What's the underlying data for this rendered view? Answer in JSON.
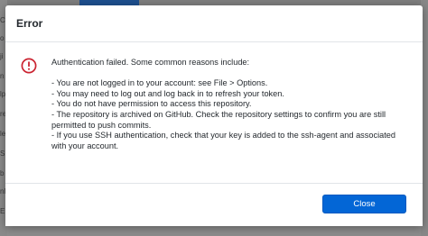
{
  "dialog": {
    "title": "Error",
    "icon": "error-circle-icon",
    "intro": "Authentication failed. Some common reasons include:",
    "reasons": [
      "- You are not logged in to your account: see File > Options.",
      "- You may need to log out and log back in to refresh your token.",
      "- You do not have permission to access this repository.",
      "- The repository is archived on GitHub. Check the repository settings to confirm you are still",
      "permitted to push commits.",
      "- If you use SSH authentication, check that your key is added to the ssh-agent and associated",
      "with your account."
    ],
    "close_label": "Close"
  },
  "background": {
    "side_fragments": [
      "C",
      "o",
      "ji",
      "n",
      "lp",
      "re",
      "le",
      "S",
      "b",
      "nl",
      "E"
    ]
  },
  "colors": {
    "accent": "#0366d6",
    "error": "#cb2431"
  }
}
